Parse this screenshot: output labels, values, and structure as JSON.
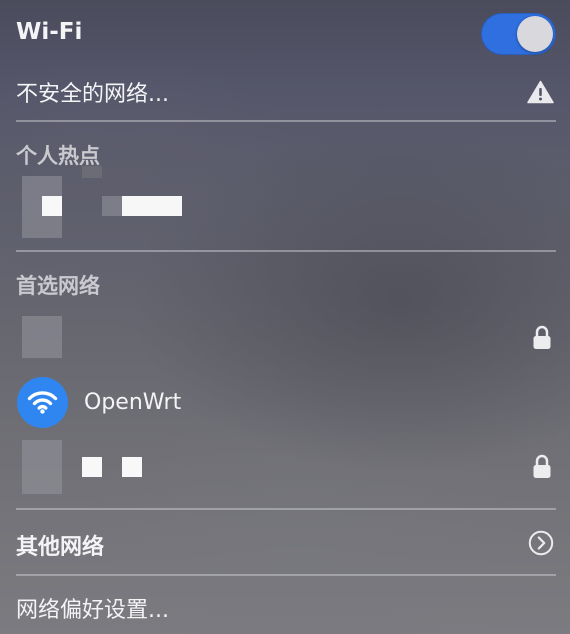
{
  "header": {
    "title": "Wi-Fi",
    "toggle_on": true,
    "accent_color": "#2f6fe0"
  },
  "insecure": {
    "label": "不安全的网络...",
    "icon": "warning-triangle-icon"
  },
  "hotspot": {
    "title": "个人热点"
  },
  "preferred": {
    "title": "首选网络",
    "networks": [
      {
        "name": "",
        "secured": true,
        "icon": "lock-icon"
      },
      {
        "name": "OpenWrt",
        "connected": true,
        "icon": "wifi-icon"
      },
      {
        "name": "",
        "secured": true,
        "icon": "lock-icon"
      }
    ]
  },
  "other_networks": {
    "label": "其他网络",
    "icon": "chevron-right-circle-icon"
  },
  "preferences": {
    "label": "网络偏好设置..."
  }
}
